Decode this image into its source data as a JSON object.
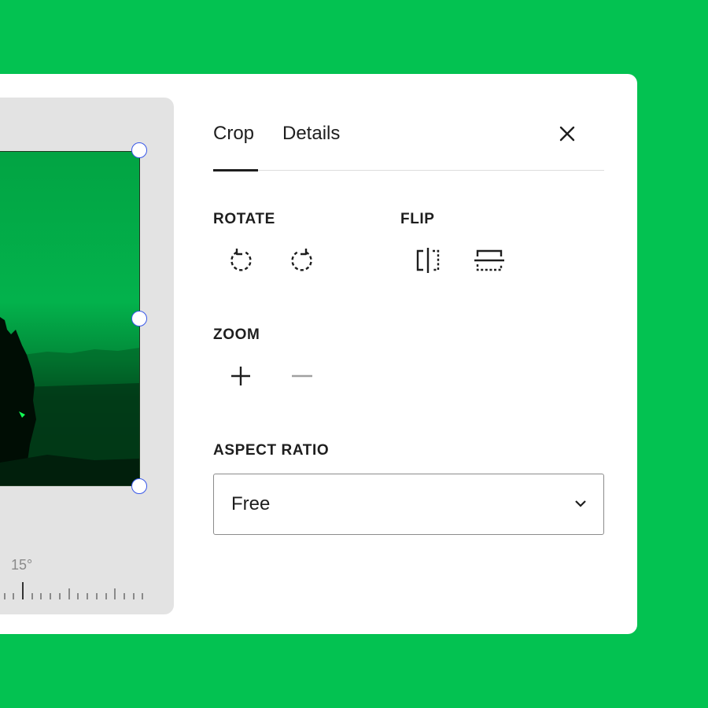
{
  "tabs": [
    {
      "label": "Crop",
      "active": true
    },
    {
      "label": "Details",
      "active": false
    }
  ],
  "close": {
    "icon": "close-icon"
  },
  "rotate": {
    "label": "ROTATE",
    "buttons": [
      {
        "icon": "rotate-left-icon"
      },
      {
        "icon": "rotate-right-icon"
      }
    ]
  },
  "flip": {
    "label": "FLIP",
    "buttons": [
      {
        "icon": "flip-horizontal-icon"
      },
      {
        "icon": "flip-vertical-icon"
      }
    ]
  },
  "zoom": {
    "label": "ZOOM",
    "buttons": [
      {
        "icon": "plus-icon",
        "enabled": true
      },
      {
        "icon": "minus-icon",
        "enabled": false
      }
    ]
  },
  "aspect_ratio": {
    "label": "ASPECT RATIO",
    "selected": "Free"
  },
  "canvas": {
    "angle_label": "15°"
  },
  "colors": {
    "background": "#03c251",
    "accent": "#3858e9",
    "text": "#1e1e1e",
    "disabled": "#a0a0a0"
  }
}
